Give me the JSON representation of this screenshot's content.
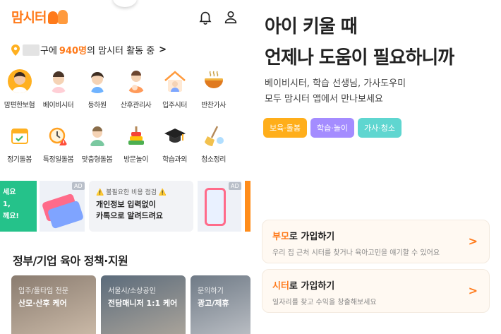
{
  "app": {
    "logo_text": "맘시터"
  },
  "header": {
    "icons": [
      "bell-icon",
      "user-icon"
    ]
  },
  "location": {
    "suffix": "구에",
    "count": "940명",
    "tail": "의 맘시터 활동 중",
    "chevron": ">"
  },
  "categories_row1": [
    {
      "label": "맘편한보험",
      "icon": "insurance-person-icon"
    },
    {
      "label": "베이비시터",
      "icon": "babysitter-icon"
    },
    {
      "label": "등하원",
      "icon": "school-commute-icon"
    },
    {
      "label": "산후관리사",
      "icon": "postpartum-care-icon"
    },
    {
      "label": "입주시터",
      "icon": "live-in-house-icon"
    },
    {
      "label": "반찬가사",
      "icon": "side-dish-bowl-icon"
    }
  ],
  "categories_row2": [
    {
      "label": "정기돌봄",
      "icon": "calendar-icon"
    },
    {
      "label": "특정일돌봄",
      "icon": "alarm-clock-icon"
    },
    {
      "label": "맞춤형돌봄",
      "icon": "custom-care-icon"
    },
    {
      "label": "방문놀이",
      "icon": "toy-stack-icon"
    },
    {
      "label": "학습과외",
      "icon": "graduation-cap-icon"
    },
    {
      "label": "청소정리",
      "icon": "broom-icon"
    }
  ],
  "banners": {
    "ad_tag": "AD",
    "green_lines": [
      "세요",
      "1,",
      "께요!"
    ],
    "info_warn": "⚠️ 불필요한 비용 점검 ⚠️",
    "info_line1": "개인정보 입력없이",
    "info_line2": "카톡으로 알려드려요"
  },
  "section": {
    "title": "정부/기업 육아 정책·지원"
  },
  "policy_cards": [
    {
      "sub": "입주/풀타임 전문",
      "main": "산모·산후 케어"
    },
    {
      "sub": "서울시/소상공인",
      "main": "전담매니저 1:1 케어"
    },
    {
      "sub": "문의하기",
      "main": "광고/제휴"
    }
  ],
  "right": {
    "headline_1": "아이 키울 때",
    "headline_2": "언제나 도움이 필요하니까",
    "desc_1": "베이비시터, 학습 선생님, 가사도우미",
    "desc_2": "모두 맘시터 앱에서 만나보세요",
    "chips": [
      "보육·돌봄",
      "학습·놀이",
      "가사·청소"
    ],
    "join_parent": {
      "highlight": "부모",
      "rest": "로 가입하기",
      "sub": "우리 집 근처 시터를 찾거나 육아고민을 얘기할 수 있어요"
    },
    "join_sitter": {
      "highlight": "시터",
      "rest": "로 가입하기",
      "sub": "일자리를 찾고 수익을 창출해보세요"
    },
    "chevron": ">"
  },
  "colors": {
    "brand": "#ff7a1a",
    "chip_1": "#ffae1a",
    "chip_2": "#a48cff",
    "chip_3": "#5fd6d0",
    "green_banner": "#25c28a"
  }
}
